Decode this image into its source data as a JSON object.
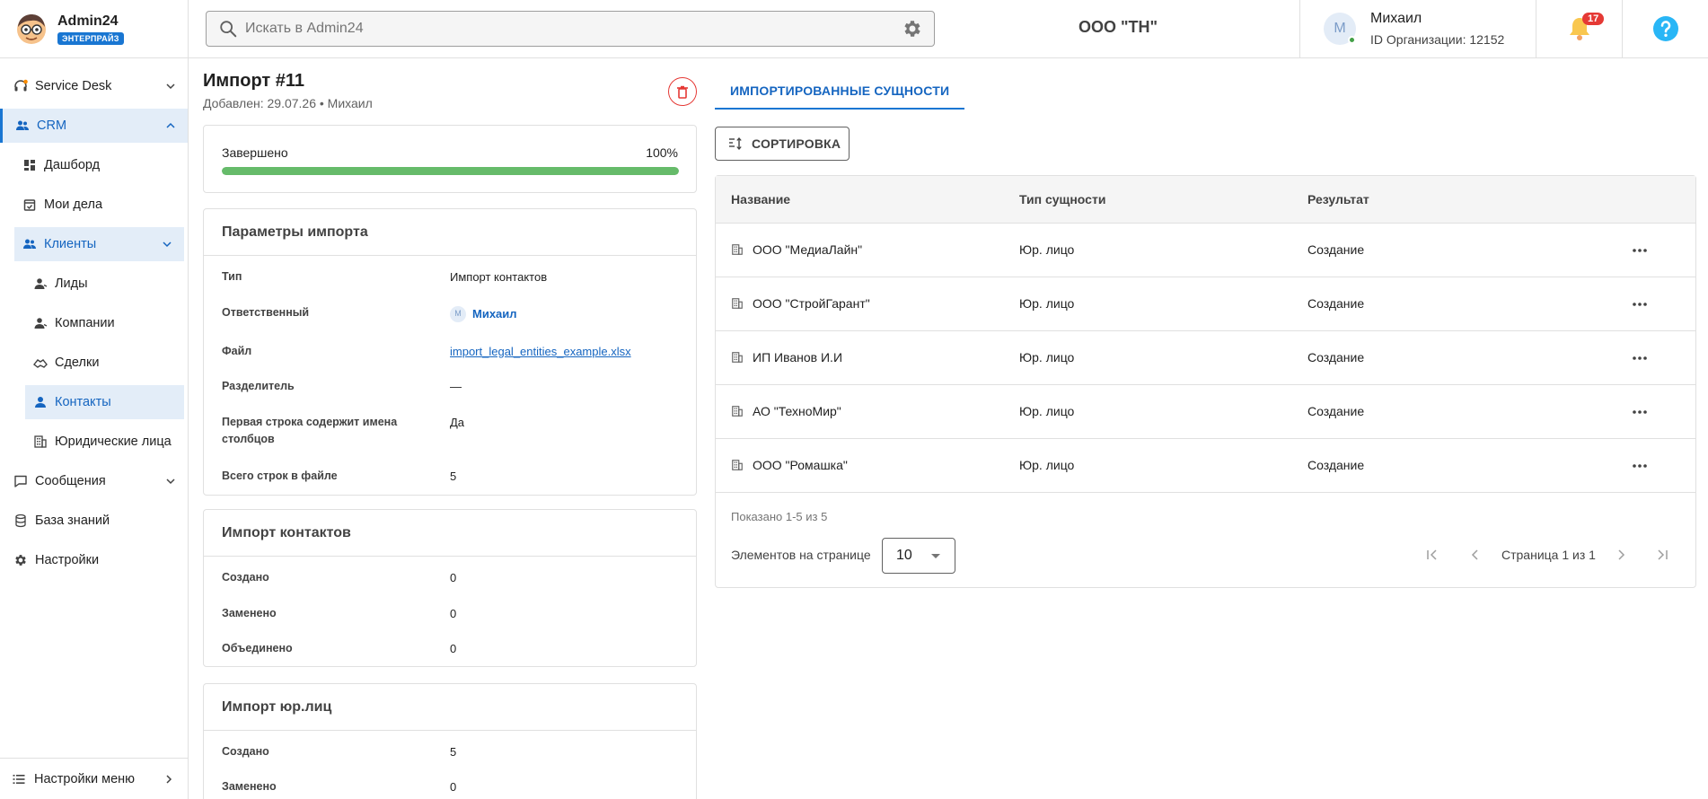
{
  "brand": {
    "name": "Admin24",
    "badge": "ЭНТЕРПРАЙЗ"
  },
  "search": {
    "placeholder": "Искать в Admin24",
    "value": ""
  },
  "header": {
    "org_name": "ООО \"ТН\"",
    "user": {
      "initial": "М",
      "name": "Михаил",
      "org_id": "ID Организации: 12152"
    },
    "notifications_count": "17"
  },
  "sidebar": {
    "items": [
      {
        "label": "Service Desk"
      },
      {
        "label": "CRM"
      },
      {
        "label": "Дашборд"
      },
      {
        "label": "Мои дела"
      },
      {
        "label": "Клиенты"
      },
      {
        "label": "Лиды"
      },
      {
        "label": "Компании"
      },
      {
        "label": "Сделки"
      },
      {
        "label": "Контакты"
      },
      {
        "label": "Юридические лица"
      },
      {
        "label": "Сообщения"
      },
      {
        "label": "База знаний"
      },
      {
        "label": "Настройки"
      }
    ],
    "menu_settings": "Настройки меню"
  },
  "import": {
    "title": "Импорт #11",
    "subtitle": "Добавлен: 29.07.26 • Михаил",
    "status": {
      "label": "Завершено",
      "percent_text": "100%",
      "percent": 100
    },
    "params": {
      "title": "Параметры импорта",
      "rows": [
        {
          "key": "Тип",
          "value": "Импорт контактов"
        },
        {
          "key": "Ответственный",
          "value": "Михаил",
          "avatar": "М"
        },
        {
          "key": "Файл",
          "value": "import_legal_entities_example.xlsx"
        },
        {
          "key": "Разделитель",
          "value": "—"
        },
        {
          "key": "Первая строка содержит имена столбцов",
          "value": "Да"
        },
        {
          "key": "Всего строк в файле",
          "value": "5"
        }
      ]
    },
    "contacts": {
      "title": "Импорт контактов",
      "rows": [
        {
          "key": "Создано",
          "value": "0"
        },
        {
          "key": "Заменено",
          "value": "0"
        },
        {
          "key": "Объединено",
          "value": "0"
        }
      ]
    },
    "legal": {
      "title": "Импорт юр.лиц",
      "rows": [
        {
          "key": "Создано",
          "value": "5"
        },
        {
          "key": "Заменено",
          "value": "0"
        }
      ]
    }
  },
  "entities": {
    "tab": "ИМПОРТИРОВАННЫЕ СУЩНОСТИ",
    "sort_label": "СОРТИРОВКА",
    "columns": [
      "Название",
      "Тип сущности",
      "Результат"
    ],
    "rows": [
      {
        "name": "ООО \"МедиаЛайн\"",
        "type": "Юр. лицо",
        "result": "Создание"
      },
      {
        "name": "ООО \"СтройГарант\"",
        "type": "Юр. лицо",
        "result": "Создание"
      },
      {
        "name": "ИП Иванов И.И",
        "type": "Юр. лицо",
        "result": "Создание"
      },
      {
        "name": "АО \"ТехноМир\"",
        "type": "Юр. лицо",
        "result": "Создание"
      },
      {
        "name": "ООО \"Ромашка\"",
        "type": "Юр. лицо",
        "result": "Создание"
      }
    ],
    "shown": "Показано 1-5 из 5",
    "per_page_label": "Элементов на странице",
    "per_page_value": "10",
    "page_label": "Страница 1 из 1"
  },
  "colors": {
    "accent": "#1976d2",
    "progress": "#66bb6a",
    "danger": "#e53935",
    "active_bg": "#e3edf8"
  }
}
